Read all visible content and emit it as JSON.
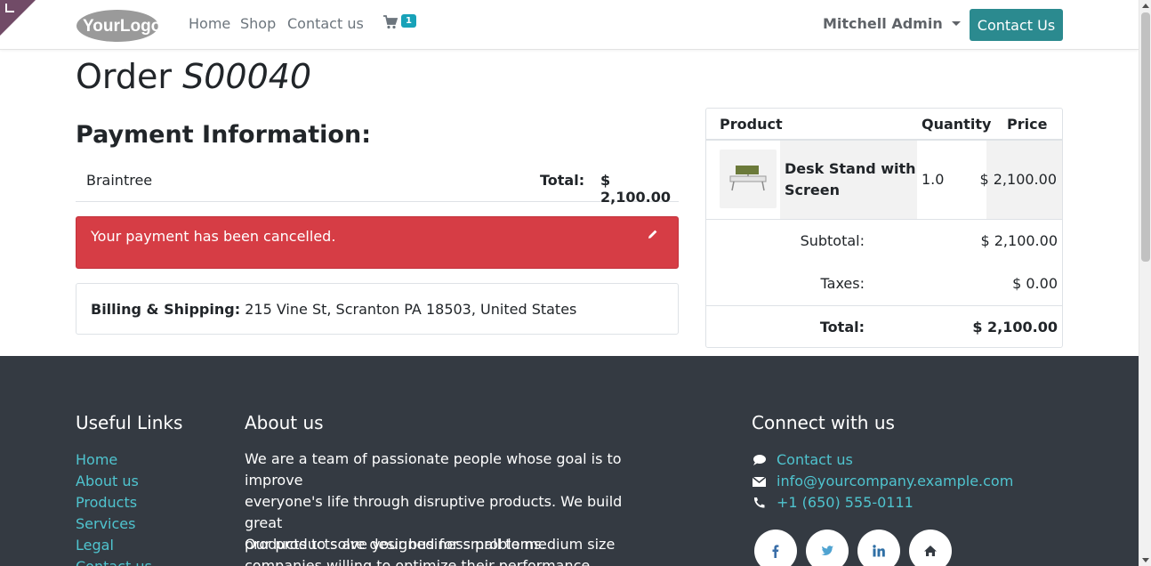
{
  "header": {
    "logo_text": "YourLogo",
    "nav": [
      "Home",
      "Shop",
      "Contact us"
    ],
    "cart_count": "1",
    "user": "Mitchell Admin",
    "contact_button": "Contact Us"
  },
  "order": {
    "title_prefix": "Order",
    "number": "S00040"
  },
  "payment": {
    "title": "Payment Information:",
    "provider": "Braintree",
    "total_label": "Total:",
    "total_value": "$ 2,100.00",
    "alert": "Your payment has been cancelled."
  },
  "address": {
    "label": "Billing & Shipping:",
    "value": "215 Vine St, Scranton PA 18503, United States"
  },
  "summary": {
    "headers": {
      "product": "Product",
      "quantity": "Quantity",
      "price": "Price"
    },
    "item": {
      "name_line1": "Desk Stand with",
      "name_line2": "Screen",
      "quantity": "1.0",
      "price": "$ 2,100.00"
    },
    "subtotal_label": "Subtotal:",
    "subtotal_value": "$ 2,100.00",
    "taxes_label": "Taxes:",
    "taxes_value": "$ 0.00",
    "total_label": "Total:",
    "total_value": "$ 2,100.00"
  },
  "footer": {
    "useful_links_title": "Useful Links",
    "useful_links": [
      "Home",
      "About us",
      "Products",
      "Services",
      "Legal",
      "Contact us"
    ],
    "about_title": "About us",
    "about_p1_l1": "We are a team of passionate people whose goal is to improve",
    "about_p1_l2": "everyone's life through disruptive products. We build great",
    "about_p1_l3": "products to solve your business problems.",
    "about_p2_l1": "Our products are designed for small to medium size",
    "about_p2_l2": "companies willing to optimize their performance.",
    "connect_title": "Connect with us",
    "connect": {
      "contact": "Contact us",
      "email": "info@yourcompany.example.com",
      "phone": "+1 (650) 555-0111"
    },
    "social_icons": [
      "facebook-icon",
      "twitter-icon",
      "linkedin-icon",
      "home-icon"
    ]
  },
  "colors": {
    "brand_purple": "#714b67",
    "teal_button": "#2b8a8f",
    "alert_red": "#d63d45",
    "footer_bg": "#343a42",
    "footer_link": "#4fc4cf"
  }
}
